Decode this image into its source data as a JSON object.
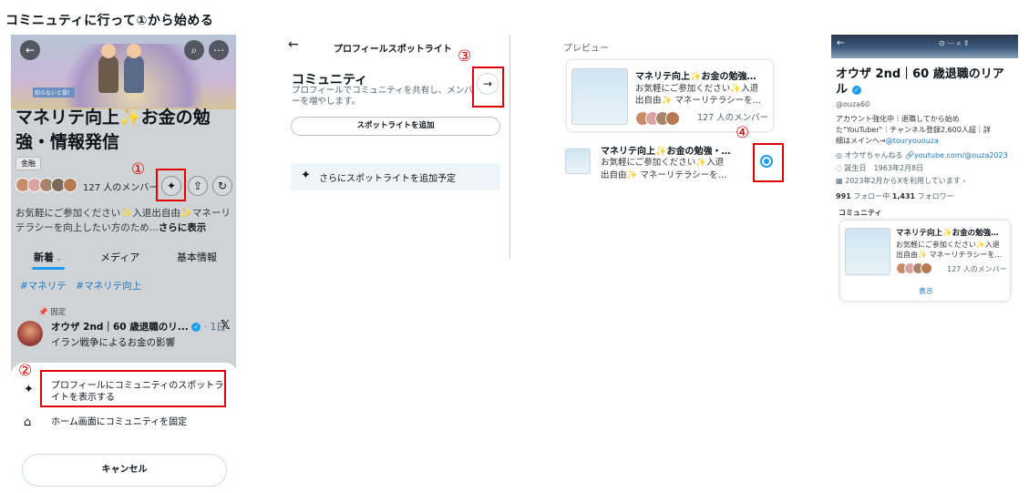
{
  "heading": "コミニュティに行って①から始める",
  "panel1": {
    "name": "マネリテ向上✨お金の勉強・情報発信",
    "tag": "金融",
    "members": "127 人のメンバー",
    "description_main": "お気軽にご参加ください✨入退出自由✨マネーリテラシーを向上したい方のため...",
    "show_more": "さらに表示",
    "tabs": [
      "新着",
      "メディア",
      "基本情報"
    ],
    "hashtags": "#マネリテ　#マネリテ向上",
    "pinned_label": "固定",
    "post_author": "オウザ 2nd｜60 歳退職のリ...",
    "post_time": "· 1日",
    "post_text": "イラン戦争によるお金の影響",
    "banner_text": "知らないと損！",
    "sheet_spotlight": "プロフィールにコミュニティのスポットライトを表示する",
    "sheet_pin": "ホーム画面にコミュニティを固定",
    "cancel": "キャンセル"
  },
  "panel2": {
    "title": "プロフィールスポットライト",
    "community_heading": "コミュニティ",
    "community_sub": "プロフィールでコミュニティを共有し、メンバーを増やします。",
    "spotlight_button": "スポットライトを追加",
    "more_coming": "さらにスポットライトを追加予定"
  },
  "panel3": {
    "preview_label": "プレビュー",
    "card_title": "マネリテ向上✨お金の勉強…",
    "card_desc_1": "お気軽にご参加ください✨入退",
    "card_desc_2": "出自由✨ マネーリテラシーを…",
    "card_members": "127 人のメンバー",
    "option_title": "マネリテ向上✨お金の勉強・…",
    "option_desc_1": "お気軽にご参加ください✨入退",
    "option_desc_2": "出自由✨ マネーリテラシーを…"
  },
  "panel4": {
    "name": "オウザ 2nd｜60 歳退職のリアル",
    "handle": "@ouza60",
    "bio_1": "アカウント強化中｜退職してから始め",
    "bio_2": "た\"YouTuber\"｜チャンネル登録2,600人超｜詳",
    "bio_3_prefix": "細はメインへ→",
    "bio_3_link": "@touryououza",
    "location": "オウザちゃんねる",
    "website": "youtube.com/@ouza2023",
    "birthday_label": "誕生日",
    "birthday": "1963年2月8日",
    "joined": "2023年2月からXを利用しています",
    "following_count": "991",
    "following_label": "フォロー中",
    "followers_count": "1,431",
    "followers_label": "フォロワー",
    "community_label": "コミュニティ",
    "card_title": "マネリテ向上✨お金の勉強…",
    "card_desc_1": "お気軽にご参加ください✨入退",
    "card_desc_2": "出自由✨ マネーリテラシーを…",
    "card_members": "127 人のメンバー",
    "show": "表示"
  },
  "markers": [
    "①",
    "②",
    "③",
    "④"
  ],
  "colors": {
    "highlight": "#e00000",
    "accent": "#1d9bf0",
    "link": "#1d78c2"
  },
  "icons": [
    "back-arrow-icon",
    "search-icon",
    "more-icon",
    "spark-icon",
    "share-icon",
    "refresh-icon",
    "pin-icon",
    "home-icon",
    "arrow-right-icon",
    "radio-selected-icon",
    "verified-icon",
    "location-icon",
    "link-icon",
    "birthday-icon",
    "calendar-icon",
    "x-logo-icon"
  ]
}
